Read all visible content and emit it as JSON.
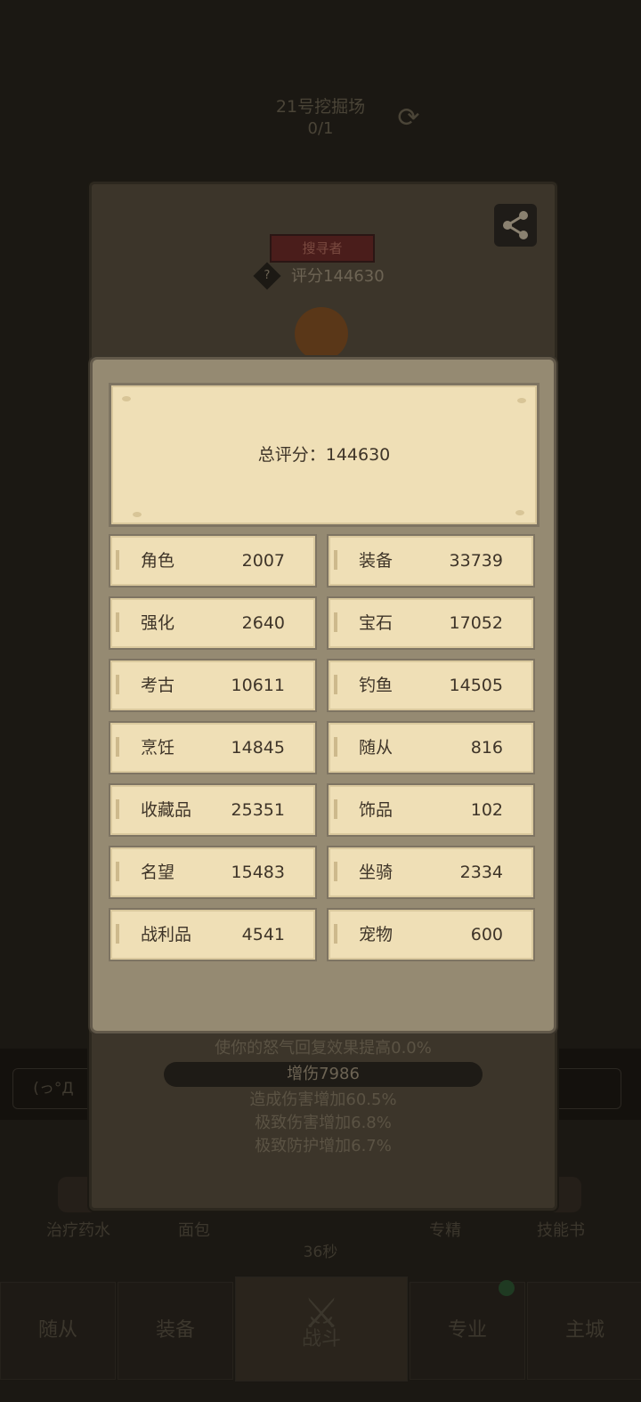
{
  "background": {
    "dig_site_title": "21号挖掘场",
    "dig_site_progress": "0/1",
    "left_button": "(っ°Д",
    "consumables": [
      "治疗药水",
      "面包",
      "专精",
      "技能书"
    ],
    "timer": "36秒",
    "nav_tabs": [
      "随从",
      "装备",
      "战斗",
      "专业",
      "主城"
    ]
  },
  "profile": {
    "role_badge": "搜寻者",
    "score_label": "评分144630",
    "bonus_line_1": "使你的怒气回复效果提高0.0%",
    "damage_bar": "增伤7986",
    "bonus_line_2": "造成伤害增加60.5%",
    "bonus_line_3": "极致伤害增加6.8%",
    "bonus_line_4": "极致防护增加6.7%"
  },
  "score_dialog": {
    "total_label": "总评分：144630",
    "categories": [
      {
        "name": "角色",
        "value": "2007"
      },
      {
        "name": "装备",
        "value": "33739"
      },
      {
        "name": "强化",
        "value": "2640"
      },
      {
        "name": "宝石",
        "value": "17052"
      },
      {
        "name": "考古",
        "value": "10611"
      },
      {
        "name": "钓鱼",
        "value": "14505"
      },
      {
        "name": "烹饪",
        "value": "14845"
      },
      {
        "name": "随从",
        "value": "816"
      },
      {
        "name": "收藏品",
        "value": "25351"
      },
      {
        "name": "饰品",
        "value": "102"
      },
      {
        "name": "名望",
        "value": "15483"
      },
      {
        "name": "坐骑",
        "value": "2334"
      },
      {
        "name": "战利品",
        "value": "4541"
      },
      {
        "name": "宠物",
        "value": "600"
      }
    ]
  },
  "icons": {
    "share": "share-icon",
    "help": "question-diamond-icon",
    "refresh": "refresh-icon",
    "battle": "crossed-swords-icon"
  }
}
